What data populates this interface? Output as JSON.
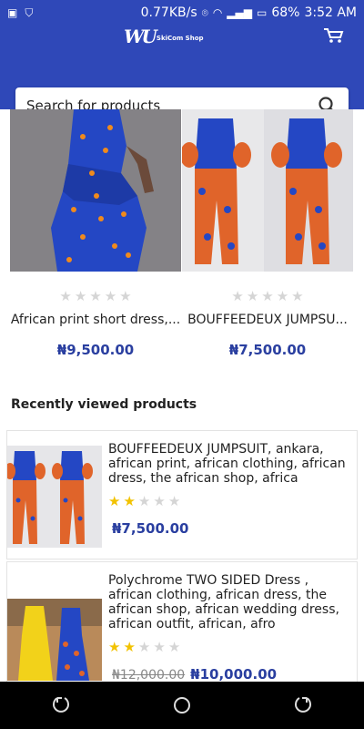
{
  "status_bar": {
    "speed": "0.77KB/s",
    "battery": "68%",
    "time": "3:52 AM"
  },
  "app": {
    "logo_mark": "SkiCom",
    "logo_text": "SkiCom Shop"
  },
  "search": {
    "placeholder": "Search for products"
  },
  "featured_products": [
    {
      "name": "African print short dress,...",
      "price": "₦9,500.00",
      "rating": 0
    },
    {
      "name": "BOUFFEEDEUX JUMPSU...",
      "price": "₦7,500.00",
      "rating": 0
    }
  ],
  "recent": {
    "title": "Recently viewed products",
    "items": [
      {
        "title": "BOUFFEEDEUX JUMPSUIT, ankara, african print, african clothing, african dress, the african shop, africa",
        "rating": 2,
        "price": "₦7,500.00",
        "old_price": ""
      },
      {
        "title": "Polychrome TWO SIDED Dress , african clothing, african dress, the african shop, african wedding dress, african outfit, african, afro",
        "rating": 2,
        "price": "₦10,000.00",
        "old_price": "₦12,000.00"
      }
    ]
  },
  "colors": {
    "primary": "#2f48b8",
    "price": "#2a3fa0",
    "star_on": "#f2c200",
    "star_off": "#d5d5d5"
  }
}
